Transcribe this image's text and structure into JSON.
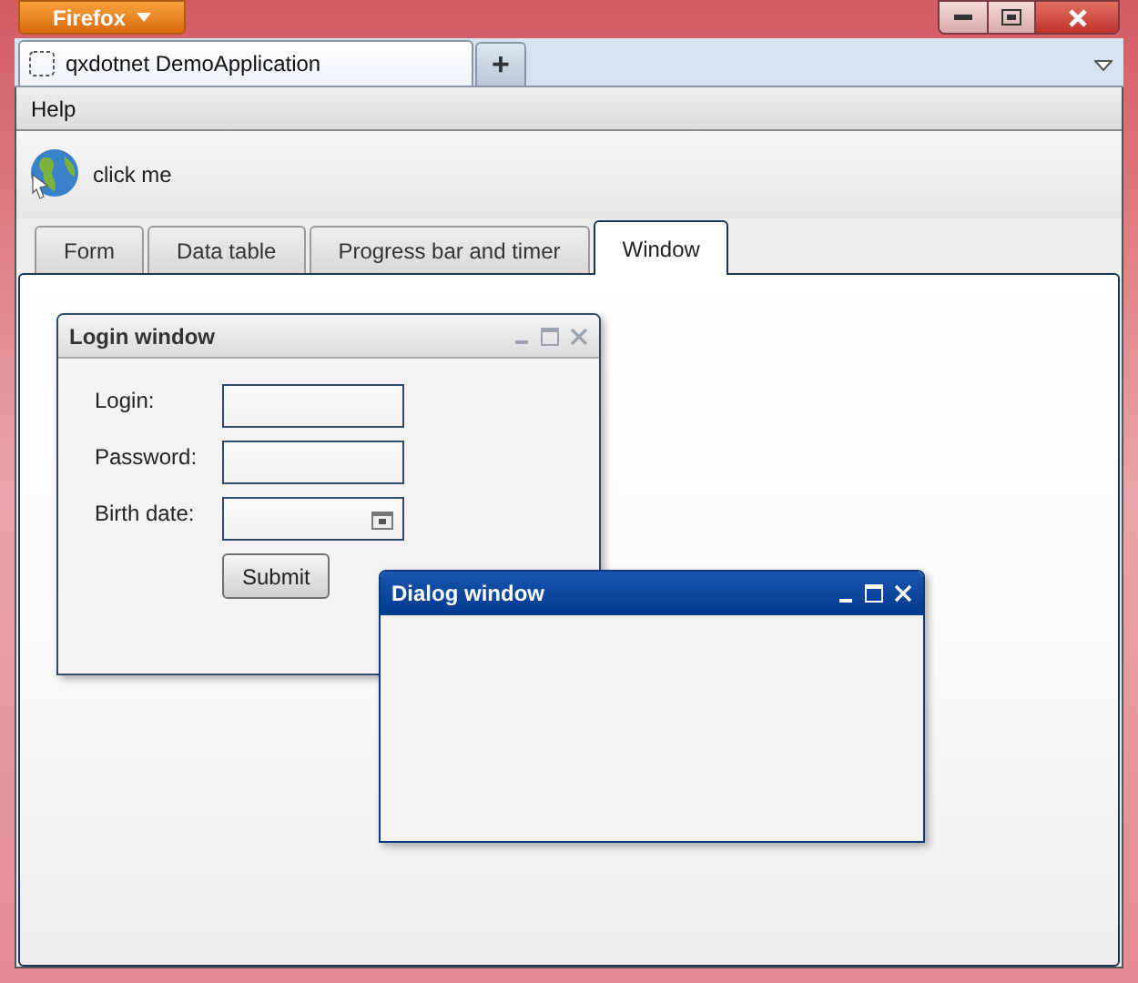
{
  "browser": {
    "app_button": "Firefox",
    "tab_title": "qxdotnet DemoApplication",
    "new_tab": "+"
  },
  "menu": [
    "Help"
  ],
  "toolbar": {
    "button": "click me"
  },
  "tabs": [
    {
      "label": "Form",
      "selected": false
    },
    {
      "label": "Data table",
      "selected": false
    },
    {
      "label": "Progress bar and timer",
      "selected": false
    },
    {
      "label": "Window",
      "selected": true
    }
  ],
  "windows": [
    {
      "title": "Login window",
      "active": false,
      "fields": [
        {
          "label": "Login:",
          "kind": "text"
        },
        {
          "label": "Password:",
          "kind": "text"
        },
        {
          "label": "Birth date:",
          "kind": "date"
        }
      ],
      "button": "Submit"
    },
    {
      "title": "Dialog window",
      "active": true
    }
  ]
}
